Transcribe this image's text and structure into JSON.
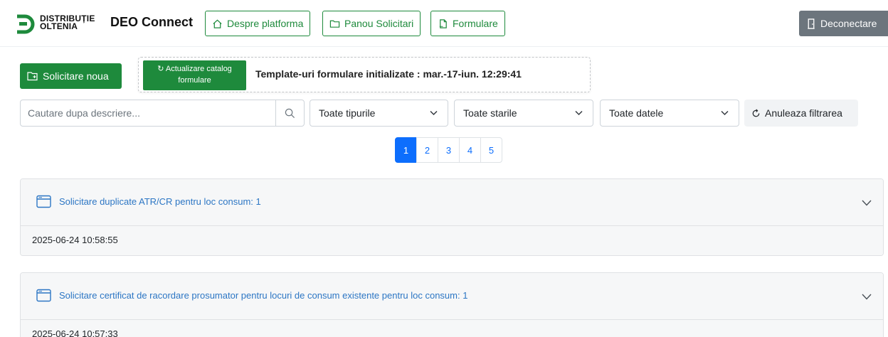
{
  "brand": {
    "line1": "DISTRIBUȚIE",
    "line2": "OLTENIA",
    "app_title": "DEO Connect"
  },
  "nav": [
    {
      "label": "Despre platforma",
      "icon": "home-icon"
    },
    {
      "label": "Panou Solicitari",
      "icon": "folder-icon"
    },
    {
      "label": "Formulare",
      "icon": "documents-icon"
    }
  ],
  "logout": {
    "label": "Deconectare",
    "icon": "door-icon"
  },
  "actions": {
    "new_request": "Solicitare noua",
    "update_catalog_line1": "Actualizare catalog",
    "update_catalog_line2": "formulare",
    "catalog_status": "Template-uri formulare initializate : mar.-17-iun. 12:29:41"
  },
  "filters": {
    "search_placeholder": "Cautare dupa descriere...",
    "type": "Toate tipurile",
    "state": "Toate starile",
    "date": "Toate datele",
    "reset": "Anuleaza filtrarea"
  },
  "pagination": {
    "pages": [
      "1",
      "2",
      "3",
      "4",
      "5"
    ],
    "active": "1"
  },
  "requests": [
    {
      "title": "Solicitare duplicate ATR/CR pentru loc consum: 1",
      "date": "2025-06-24 10:58:55"
    },
    {
      "title": "Solicitare certificat de racordare prosumator pentru locuri de consum existente pentru loc consum: 1",
      "date": "2025-06-24 10:57:33"
    }
  ],
  "colors": {
    "accent": "#1e8a3c",
    "link": "#2c76c4",
    "page_active": "#0d6efd",
    "logout": "#6c757d"
  }
}
